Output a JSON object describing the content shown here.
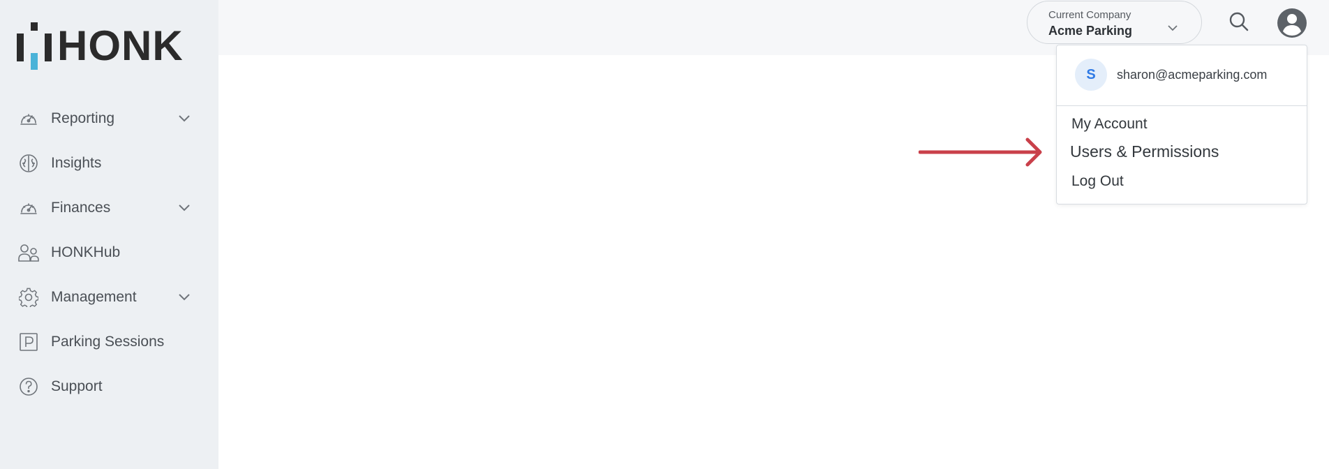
{
  "brand": {
    "name": "HONK",
    "accent": "#4ab3d8"
  },
  "sidebar": {
    "items": [
      {
        "label": "Reporting",
        "icon": "speedometer-icon",
        "expandable": true
      },
      {
        "label": "Insights",
        "icon": "brain-icon",
        "expandable": false
      },
      {
        "label": "Finances",
        "icon": "speedometer-icon",
        "expandable": true
      },
      {
        "label": "HONKHub",
        "icon": "users-icon",
        "expandable": false
      },
      {
        "label": "Management",
        "icon": "gear-icon",
        "expandable": true
      },
      {
        "label": "Parking Sessions",
        "icon": "parking-icon",
        "expandable": false
      },
      {
        "label": "Support",
        "icon": "help-circle-icon",
        "expandable": false
      }
    ]
  },
  "header": {
    "company_caption": "Current Company",
    "company_name": "Acme Parking"
  },
  "user_menu": {
    "avatar_initial": "S",
    "email": "sharon@acmeparking.com",
    "items": [
      "My Account",
      "Users & Permissions",
      "Log Out"
    ]
  },
  "annotation": {
    "arrow_color": "#c9404a",
    "points_to": "Users & Permissions"
  }
}
